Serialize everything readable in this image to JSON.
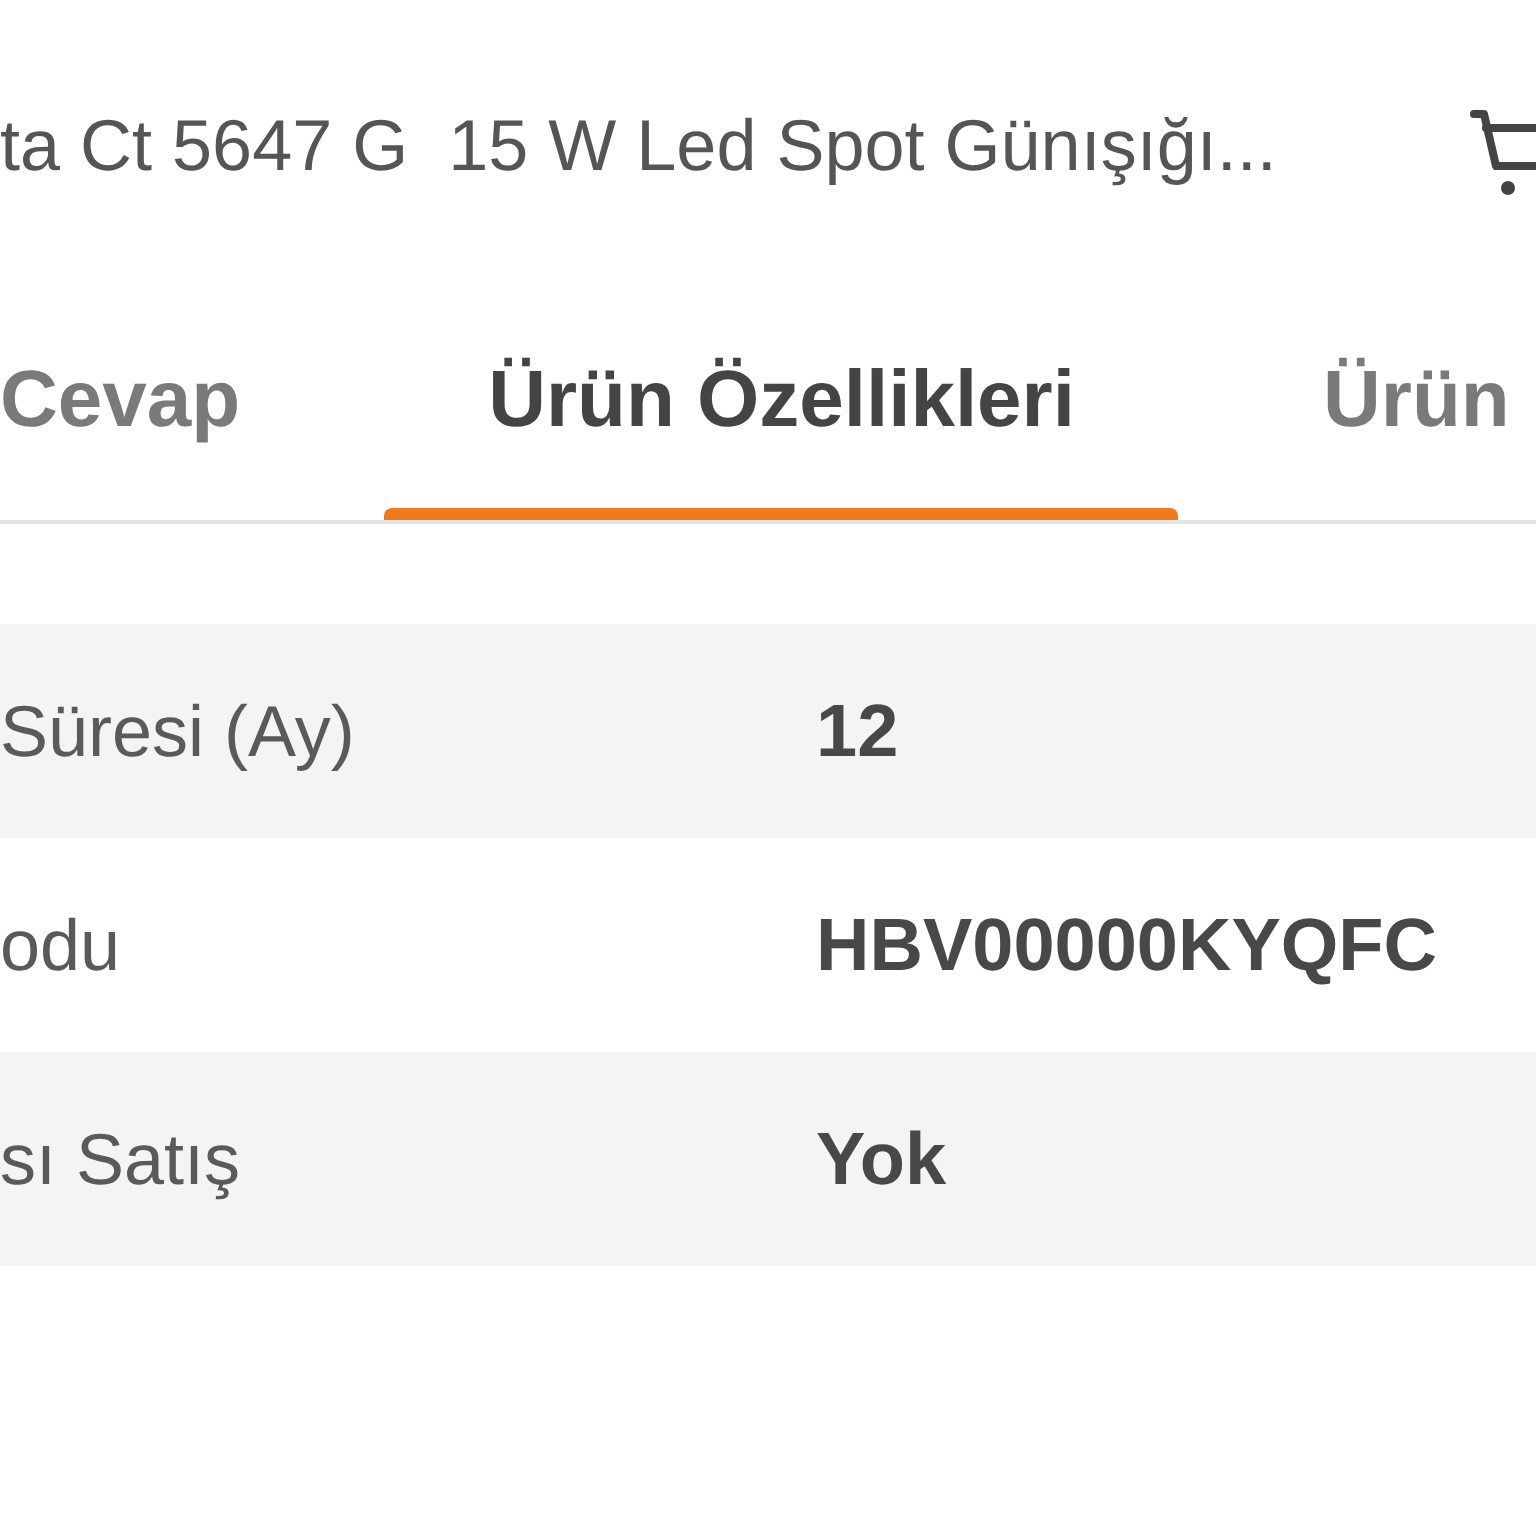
{
  "header": {
    "title": "ta Ct 5647 G  15 W Led Spot Günışığı..."
  },
  "tabs": [
    {
      "label": "Cevap",
      "selected": false
    },
    {
      "label": "Ürün Özellikleri",
      "selected": true
    },
    {
      "label": "Ürün",
      "selected": false
    }
  ],
  "properties": [
    {
      "name": "Süresi (Ay)",
      "value": "12"
    },
    {
      "name": "odu",
      "value": "HBV00000KYQFC"
    },
    {
      "name": "sı Satış",
      "value": "Yok"
    }
  ]
}
